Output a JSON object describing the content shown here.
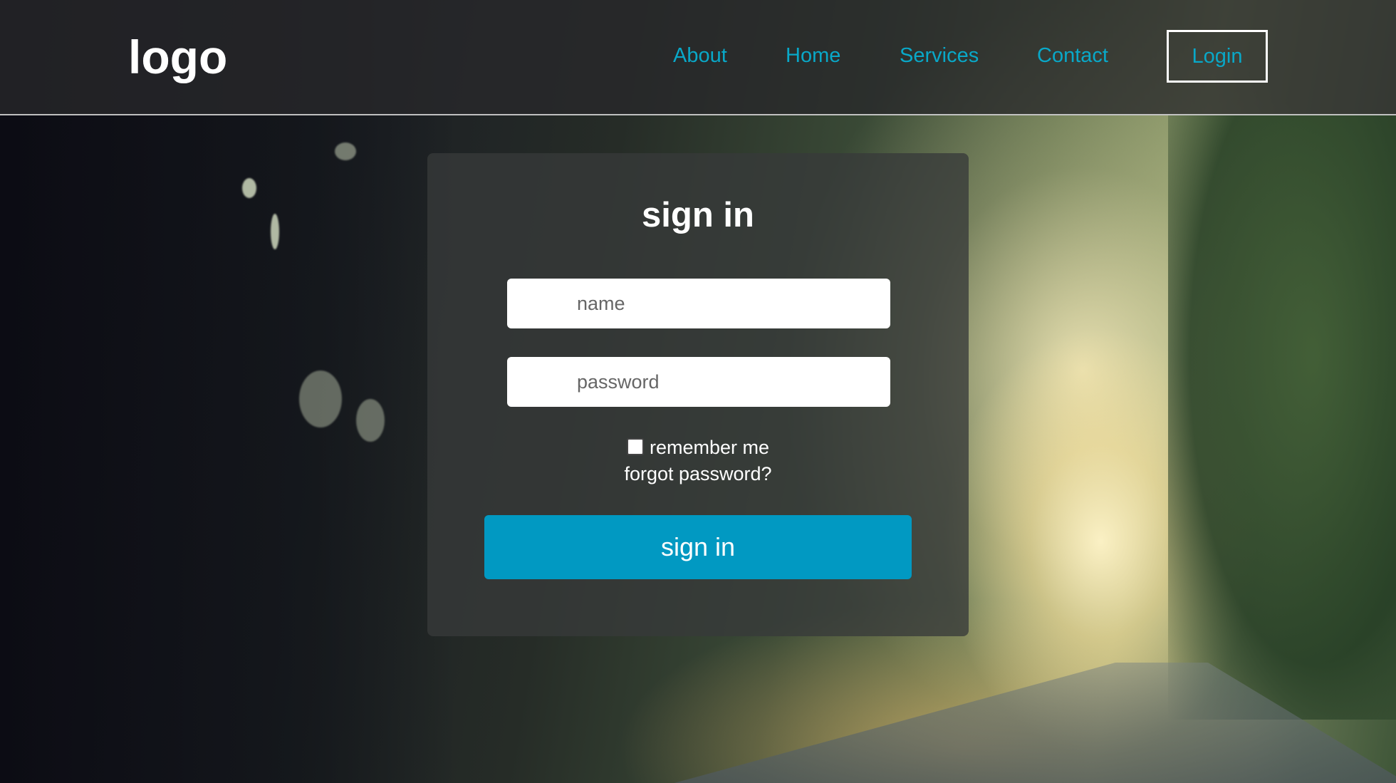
{
  "header": {
    "logo": "logo",
    "nav": [
      "About",
      "Home",
      "Services",
      "Contact"
    ],
    "login_label": "Login"
  },
  "signin": {
    "title": "sign in",
    "name_placeholder": "name",
    "password_placeholder": "password",
    "remember_label": "remember me",
    "forgot_label": "forgot password?",
    "submit_label": "sign in"
  },
  "colors": {
    "accent": "#0199c2",
    "nav_link": "#09a8c8"
  }
}
